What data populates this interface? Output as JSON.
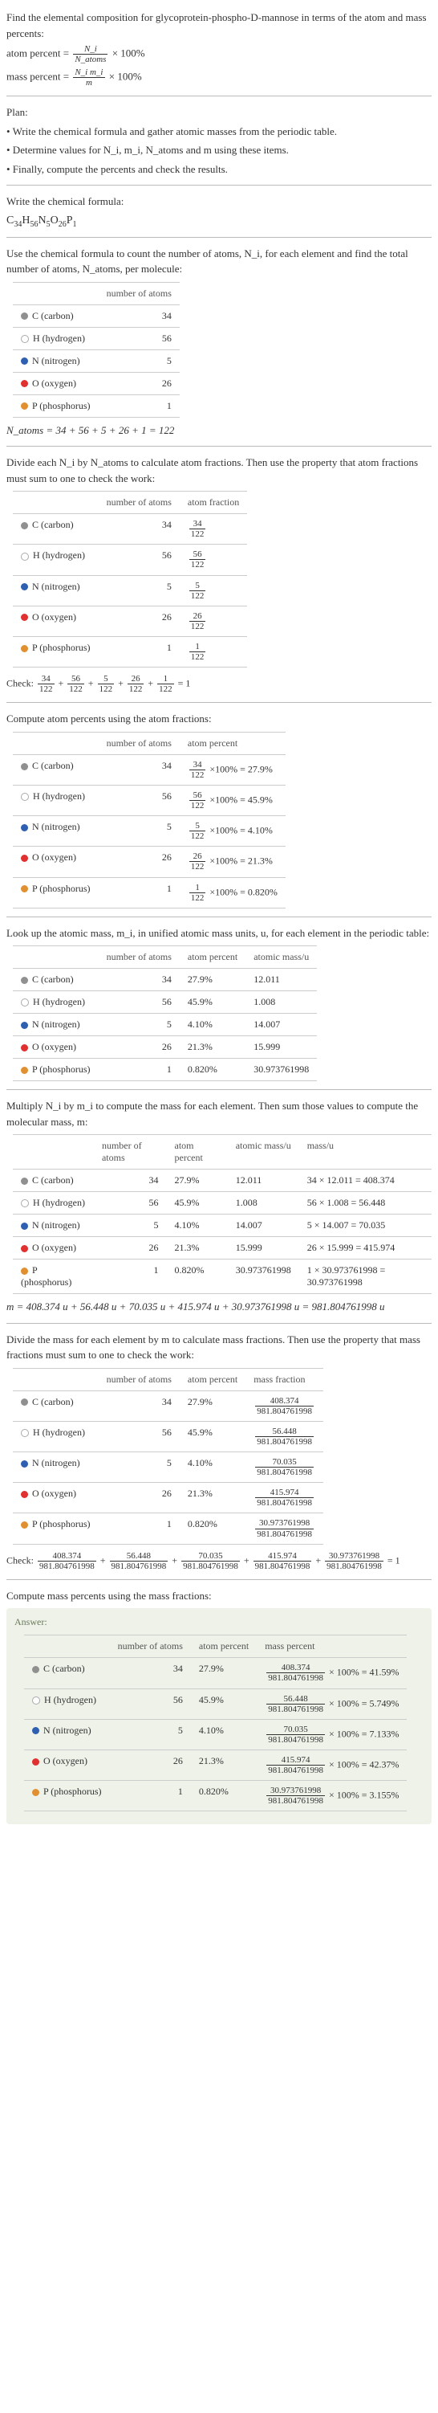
{
  "intro": {
    "line1": "Find the elemental composition for glycoprotein-phospho-D-mannose in terms of the atom and mass percents:",
    "atom_percent_lhs": "atom percent =",
    "atom_percent_rhs": "× 100%",
    "mass_percent_lhs": "mass percent =",
    "mass_percent_rhs": "× 100%",
    "frac_atom_num": "N_i",
    "frac_atom_den": "N_atoms",
    "frac_mass_num": "N_i m_i",
    "frac_mass_den": "m"
  },
  "plan": {
    "heading": "Plan:",
    "b1": "• Write the chemical formula and gather atomic masses from the periodic table.",
    "b2": "• Determine values for N_i, m_i, N_atoms and m using these items.",
    "b3": "• Finally, compute the percents and check the results."
  },
  "step1": {
    "text": "Write the chemical formula:",
    "formula_parts": [
      "C",
      "34",
      "H",
      "56",
      "N",
      "5",
      "O",
      "26",
      "P",
      "1"
    ]
  },
  "step2": {
    "text": "Use the chemical formula to count the number of atoms, N_i, for each element and find the total number of atoms, N_atoms, per molecule:"
  },
  "elements": [
    {
      "sym": "C",
      "name": "C (carbon)",
      "dot": "dot-c"
    },
    {
      "sym": "H",
      "name": "H (hydrogen)",
      "dot": "dot-h"
    },
    {
      "sym": "N",
      "name": "N (nitrogen)",
      "dot": "dot-n"
    },
    {
      "sym": "O",
      "name": "O (oxygen)",
      "dot": "dot-o"
    },
    {
      "sym": "P",
      "name": "P (phosphorus)",
      "dot": "dot-p"
    }
  ],
  "table1": {
    "h_num": "number of atoms",
    "counts": [
      "34",
      "56",
      "5",
      "26",
      "1"
    ]
  },
  "natoms_line": "N_atoms = 34 + 56 + 5 + 26 + 1 = 122",
  "step3": {
    "text": "Divide each N_i by N_atoms to calculate atom fractions. Then use the property that atom fractions must sum to one to check the work:"
  },
  "table2": {
    "h_num": "number of atoms",
    "h_frac": "atom fraction",
    "fracs": [
      {
        "num": "34",
        "den": "122"
      },
      {
        "num": "56",
        "den": "122"
      },
      {
        "num": "5",
        "den": "122"
      },
      {
        "num": "26",
        "den": "122"
      },
      {
        "num": "1",
        "den": "122"
      }
    ]
  },
  "check1_label": "Check:",
  "check1_rhs": "= 1",
  "step4": {
    "text": "Compute atom percents using the atom fractions:"
  },
  "table3": {
    "h_num": "number of atoms",
    "h_pct": "atom percent",
    "pcts": [
      "27.9%",
      "45.9%",
      "4.10%",
      "21.3%",
      "0.820%"
    ]
  },
  "step5": {
    "text": "Look up the atomic mass, m_i, in unified atomic mass units, u, for each element in the periodic table:"
  },
  "table4": {
    "h_num": "number of atoms",
    "h_pct": "atom percent",
    "h_mass": "atomic mass/u",
    "masses": [
      "12.011",
      "1.008",
      "14.007",
      "15.999",
      "30.973761998"
    ]
  },
  "step6": {
    "text": "Multiply N_i by m_i to compute the mass for each element. Then sum those values to compute the molecular mass, m:"
  },
  "table5": {
    "h_num": "number of atoms",
    "h_pct": "atom percent",
    "h_mass": "atomic mass/u",
    "h_massu": "mass/u",
    "prods": [
      "34 × 12.011 = 408.374",
      "56 × 1.008 = 56.448",
      "5 × 14.007 = 70.035",
      "26 × 15.999 = 415.974",
      "1 × 30.973761998 = 30.973761998"
    ]
  },
  "mline": "m = 408.374 u + 56.448 u + 70.035 u + 415.974 u + 30.973761998 u = 981.804761998 u",
  "step7": {
    "text": "Divide the mass for each element by m to calculate mass fractions. Then use the property that mass fractions must sum to one to check the work:"
  },
  "table6": {
    "h_num": "number of atoms",
    "h_pct": "atom percent",
    "h_mfrac": "mass fraction",
    "mfracs": [
      {
        "num": "408.374",
        "den": "981.804761998"
      },
      {
        "num": "56.448",
        "den": "981.804761998"
      },
      {
        "num": "70.035",
        "den": "981.804761998"
      },
      {
        "num": "415.974",
        "den": "981.804761998"
      },
      {
        "num": "30.973761998",
        "den": "981.804761998"
      }
    ]
  },
  "check2_label": "Check:",
  "check2_rhs": "= 1",
  "step8": {
    "text": "Compute mass percents using the mass fractions:"
  },
  "answer": {
    "label": "Answer:",
    "h_num": "number of atoms",
    "h_pct": "atom percent",
    "h_mpct": "mass percent",
    "rows": [
      {
        "frac_num": "408.374",
        "frac_den": "981.804761998",
        "pct": "× 100% = 41.59%"
      },
      {
        "frac_num": "56.448",
        "frac_den": "981.804761998",
        "pct": "× 100% = 5.749%"
      },
      {
        "frac_num": "70.035",
        "frac_den": "981.804761998",
        "pct": "× 100% = 7.133%"
      },
      {
        "frac_num": "415.974",
        "frac_den": "981.804761998",
        "pct": "× 100% = 42.37%"
      },
      {
        "frac_num": "30.973761998",
        "frac_den": "981.804761998",
        "pct": "× 100% = 3.155%"
      }
    ]
  },
  "times100": "×100% ="
}
